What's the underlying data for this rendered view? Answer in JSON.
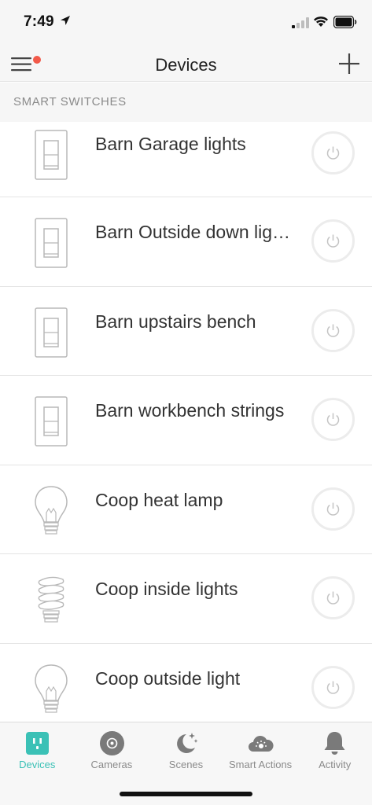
{
  "status_bar": {
    "time": "7:49",
    "icons": [
      "location-arrow-icon",
      "cellular-signal-icon",
      "wifi-icon",
      "battery-icon"
    ]
  },
  "nav": {
    "title": "Devices",
    "menu_icon": "hamburger-menu-icon",
    "add_icon": "plus-icon",
    "notification_dot_color": "#f25a4a"
  },
  "section": {
    "label": "SMART SWITCHES"
  },
  "devices": [
    {
      "name": "Barn Garage lights",
      "icon": "wall-switch-icon"
    },
    {
      "name": "Barn Outside down lig…",
      "icon": "wall-switch-icon"
    },
    {
      "name": "Barn upstairs bench",
      "icon": "wall-switch-icon"
    },
    {
      "name": "Barn workbench strings",
      "icon": "wall-switch-icon"
    },
    {
      "name": "Coop heat lamp",
      "icon": "light-bulb-icon"
    },
    {
      "name": "Coop inside lights",
      "icon": "cfl-bulb-icon"
    },
    {
      "name": "Coop outside light",
      "icon": "light-bulb-icon"
    }
  ],
  "tabs": [
    {
      "label": "Devices",
      "icon": "outlet-icon",
      "active": true
    },
    {
      "label": "Cameras",
      "icon": "camera-icon",
      "active": false
    },
    {
      "label": "Scenes",
      "icon": "moon-stars-icon",
      "active": false
    },
    {
      "label": "Smart Actions",
      "icon": "cloud-sun-icon",
      "active": false
    },
    {
      "label": "Activity",
      "icon": "bell-icon",
      "active": false
    }
  ],
  "colors": {
    "accent": "#3bc1b6",
    "inactive_tab": "#8a8a8a",
    "header_bg": "#f6f6f6"
  }
}
